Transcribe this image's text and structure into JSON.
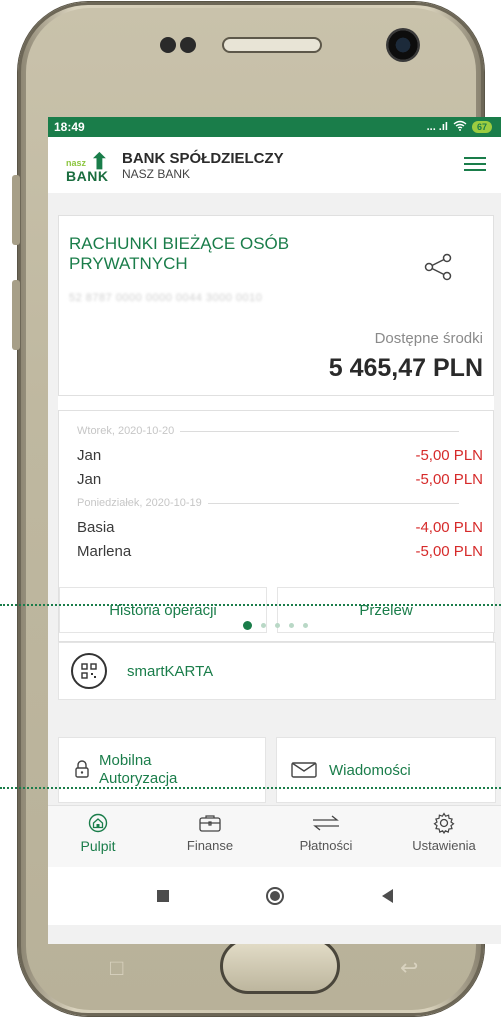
{
  "status": {
    "time": "18:49",
    "signal_text": "... .ıl",
    "battery": "67"
  },
  "header": {
    "logo_small": "nasz",
    "logo_main": "BANK",
    "bank_name": "BANK SPÓŁDZIELCZY",
    "bank_sub": "NASZ BANK"
  },
  "account": {
    "title": "RACHUNKI BIEŻĄCE OSÓB PRYWATNYCH",
    "number": "52 8787 0000 0000 0044 3000 0010",
    "available_label": "Dostępne środki",
    "available_amount": "5 465,47 PLN"
  },
  "transactions": {
    "groups": [
      {
        "date": "Wtorek, 2020-10-20",
        "items": [
          {
            "name": "Jan",
            "amount": "-5,00 PLN"
          },
          {
            "name": "Jan",
            "amount": "-5,00 PLN"
          }
        ]
      },
      {
        "date": "Poniedziałek, 2020-10-19",
        "items": [
          {
            "name": "Basia",
            "amount": "-4,00 PLN"
          },
          {
            "name": "Marlena",
            "amount": "-5,00 PLN"
          }
        ]
      }
    ],
    "history_button": "Historia operacji",
    "transfer_button": "Przelew"
  },
  "carousel": {
    "pages": 5,
    "active": 1
  },
  "tiles": {
    "smartkarta": "smartKARTA",
    "mobile_auth": "Mobilna Autoryzacja",
    "messages": "Wiadomości"
  },
  "nav": [
    {
      "label": "Pulpit",
      "icon": "home-icon",
      "active": true
    },
    {
      "label": "Finanse",
      "icon": "briefcase-icon",
      "active": false
    },
    {
      "label": "Płatności",
      "icon": "transfer-arrows-icon",
      "active": false
    },
    {
      "label": "Ustawienia",
      "icon": "gear-icon",
      "active": false
    }
  ],
  "colors": {
    "brand": "#1a7d4a",
    "negative": "#d62a2a",
    "accent": "#8cc63f"
  }
}
